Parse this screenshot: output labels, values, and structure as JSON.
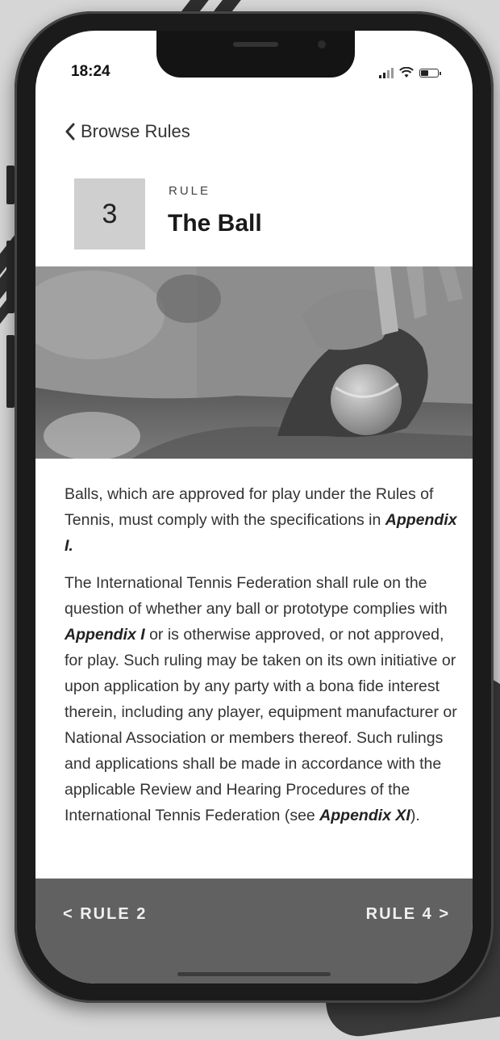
{
  "status_bar": {
    "time": "18:24"
  },
  "nav": {
    "back_label": "Browse Rules"
  },
  "rule": {
    "number": "3",
    "label": "RULE",
    "title": "The Ball"
  },
  "content": {
    "p1_pre": "Balls, which are approved for play under the Rules of Tennis, must comply with the specifications in ",
    "p1_em": "Appendix I.",
    "p2_a": "The International Tennis Federation shall rule on the question of whether any ball or prototype complies with ",
    "p2_em1": "Appendix I",
    "p2_b": " or is otherwise approved, or not approved, for play. Such ruling may be taken on its own initiative or upon application by any party with a bona fide interest therein, including any player, equipment manufacturer or National Association or members thereof. Such rulings and applications shall be made in accordance with the applicable Review and Hearing Procedures of the International Tennis Federation (see ",
    "p2_em2": "Appendix XI",
    "p2_c": ")."
  },
  "footer_nav": {
    "prev_label": "< RULE 2",
    "next_label": "RULE 4 >"
  },
  "icons": {
    "back": "chevron-left-icon",
    "signal": "cellular-signal-icon",
    "wifi": "wifi-icon",
    "battery": "battery-icon"
  }
}
